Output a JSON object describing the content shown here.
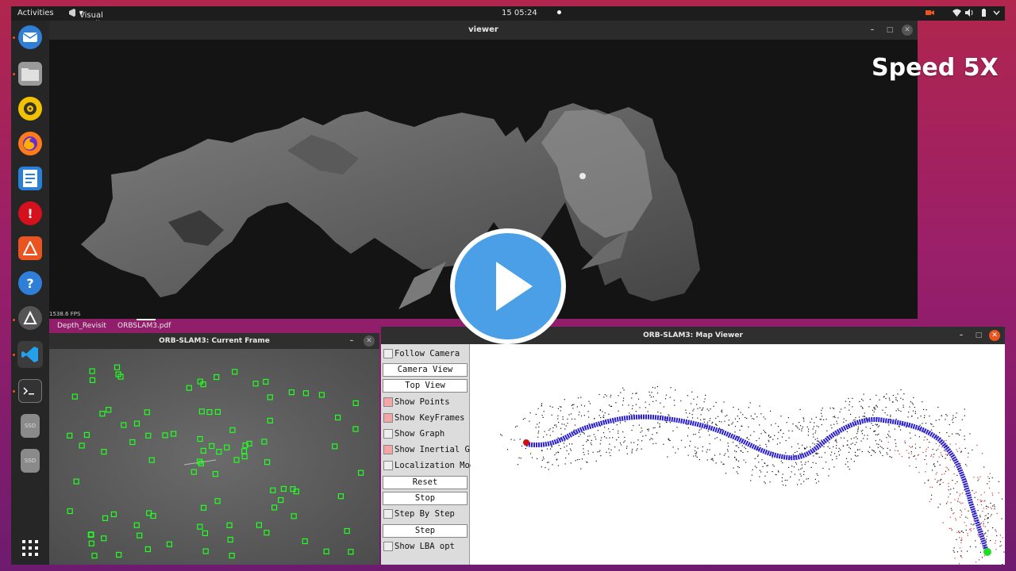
{
  "topbar": {
    "activities": "Activities",
    "app_name": "Visual Studio Code",
    "clock": "15  05:24"
  },
  "dock": {
    "apps": [
      "thunderbird-icon",
      "files-icon",
      "rhythmbox-icon",
      "firefox-icon",
      "writer-icon",
      "alert-icon",
      "software-icon",
      "help-icon",
      "update-icon",
      "vscode-icon",
      "terminal-icon",
      "ssd-icon",
      "ssd-icon",
      "app-grid-icon"
    ],
    "ssd_label": "SSD"
  },
  "viewer": {
    "title": "viewer",
    "fps": "1538.6 FPS"
  },
  "overlay": {
    "speed": "Speed 5X"
  },
  "taskbar": {
    "tab1": "Depth_Revisit",
    "tab2": "ORBSLAM3.pdf"
  },
  "current_frame": {
    "title": "ORB-SLAM3: Current Frame"
  },
  "map_viewer": {
    "title": "ORB-SLAM3: Map Viewer",
    "controls": {
      "follow_camera": "Follow Camera",
      "camera_view": "Camera View",
      "top_view": "Top View",
      "show_points": "Show Points",
      "show_keyframes": "Show KeyFrames",
      "show_graph": "Show Graph",
      "show_inertial_graph": "Show Inertial Graph",
      "localization_mode": "Localization Mode",
      "reset": "Reset",
      "stop": "Stop",
      "step_by_step": "Step By Step",
      "step": "Step",
      "show_lba_opt": "Show LBA opt"
    },
    "checked": {
      "follow_camera": false,
      "show_points": true,
      "show_keyframes": true,
      "show_graph": false,
      "show_inertial_graph": true,
      "localization_mode": false,
      "step_by_step": false,
      "show_lba_opt": false
    }
  },
  "colors": {
    "trajectory": "#2a1fd0",
    "feature_box": "#22ff22",
    "play_button": "#4a9fe6",
    "desktop_accent": "#b0264d"
  }
}
